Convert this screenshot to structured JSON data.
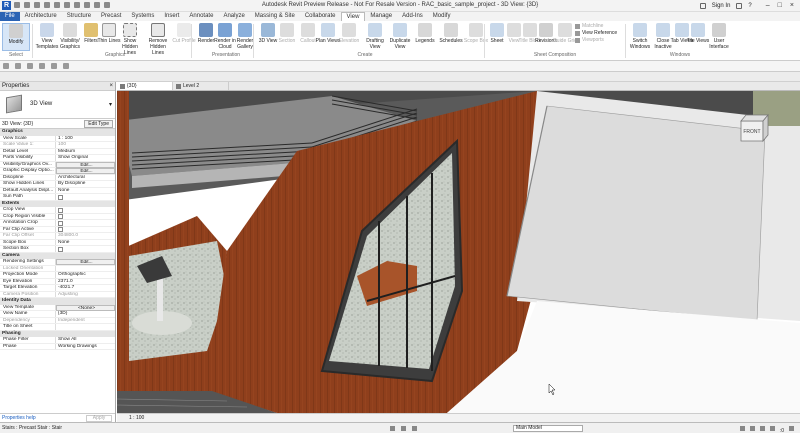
{
  "window": {
    "title": "Autodesk Revit Preview Release - Not For Resale Version - RAC_basic_sample_project - 3D View: {3D}",
    "app_logo": "R",
    "sign_in": "Sign In",
    "help": "?"
  },
  "ribbon_tabs": [
    "File",
    "Architecture",
    "Structure",
    "Precast",
    "Systems",
    "Insert",
    "Annotate",
    "Analyze",
    "Massing & Site",
    "Collaborate",
    "View",
    "Manage",
    "Add-Ins",
    "Modify"
  ],
  "active_tab": "View",
  "ribbon": {
    "modify": "Modify",
    "view_templates": "View Templates",
    "visibility_graphics": "Visibility/ Graphics",
    "filters": "Filters",
    "thin_lines": "Thin Lines",
    "show_hidden_lines": "Show Hidden Lines",
    "remove_hidden_lines": "Remove Hidden Lines",
    "cut_profile": "Cut Profile",
    "render": "Render",
    "render_in_cloud": "Render in Cloud",
    "render_gallery": "Render Gallery",
    "view_3d": "3D View",
    "section": "Section",
    "callout": "Callout",
    "plan_views": "Plan Views",
    "elevation": "Elevation",
    "drafting_view": "Drafting View",
    "duplicate_view": "Duplicate View",
    "legends": "Legends",
    "schedules": "Schedules",
    "scope_box": "Scope Box",
    "sheet": "Sheet",
    "view": "View",
    "title_block": "Title Block",
    "revisions": "Revisions",
    "guide_grid": "Guide Grid",
    "matchline": "Matchline",
    "view_reference": "View Reference",
    "viewports": "Viewports",
    "switch_windows": "Switch Windows",
    "close_inactive": "Close Inactive",
    "tab_views": "Tab Views",
    "tile_views": "Tile Views",
    "user_interface": "User Interface",
    "groups": {
      "select": "Select",
      "graphics": "Graphics",
      "presentation": "Presentation",
      "create": "Create",
      "sheet_composition": "Sheet Composition",
      "windows": "Windows"
    }
  },
  "properties": {
    "title": "Properties",
    "type_name": "3D View",
    "filter_value": "3D View: {3D}",
    "edit_type": "Edit Type",
    "sections": {
      "graphics": "Graphics",
      "extents": "Extents",
      "camera": "Camera",
      "identity": "Identity Data",
      "phasing": "Phasing"
    },
    "graphics_rows": [
      {
        "k": "View Scale",
        "v": "1 : 100"
      },
      {
        "k": "Scale Value    1:",
        "v": "100",
        "dim": true
      },
      {
        "k": "Detail Level",
        "v": "Medium"
      },
      {
        "k": "Parts Visibility",
        "v": "Show Original"
      },
      {
        "k": "Visibility/Graphics Ov...",
        "v": "Edit...",
        "btn": true
      },
      {
        "k": "Graphic Display Optio...",
        "v": "Edit...",
        "btn": true
      },
      {
        "k": "Discipline",
        "v": "Architectural"
      },
      {
        "k": "Show Hidden Lines",
        "v": "By Discipline"
      },
      {
        "k": "Default Analysis Displ...",
        "v": "None"
      },
      {
        "k": "Sun Path",
        "v": "",
        "chk": true
      }
    ],
    "extents_rows": [
      {
        "k": "Crop View",
        "v": "",
        "chk": true
      },
      {
        "k": "Crop Region Visible",
        "v": "",
        "chk": true
      },
      {
        "k": "Annotation Crop",
        "v": "",
        "chk": true
      },
      {
        "k": "Far Clip Active",
        "v": "",
        "chk": true
      },
      {
        "k": "Far Clip Offset",
        "v": "304800.0",
        "dim": true
      },
      {
        "k": "Scope Box",
        "v": "None"
      },
      {
        "k": "Section Box",
        "v": "",
        "chk": true
      }
    ],
    "camera_rows": [
      {
        "k": "Rendering Settings",
        "v": "Edit...",
        "btn": true
      },
      {
        "k": "Locked Orientation",
        "v": "",
        "dim": true
      },
      {
        "k": "Projection Mode",
        "v": "Orthographic"
      },
      {
        "k": "Eye Elevation",
        "v": "2371.0"
      },
      {
        "k": "Target Elevation",
        "v": "-4021.7"
      },
      {
        "k": "Camera Position",
        "v": "Adjusting",
        "dim": true
      }
    ],
    "identity_rows": [
      {
        "k": "View Template",
        "v": "<None>",
        "btn": true
      },
      {
        "k": "View Name",
        "v": "{3D}"
      },
      {
        "k": "Dependency",
        "v": "Independent",
        "dim": true
      },
      {
        "k": "Title on Sheet",
        "v": ""
      }
    ],
    "phasing_rows": [
      {
        "k": "Phase Filter",
        "v": "Show All"
      },
      {
        "k": "Phase",
        "v": "Working Drawings"
      }
    ],
    "help_link": "Properties help",
    "apply": "Apply"
  },
  "view_tabs": [
    {
      "label": "{3D}",
      "active": true
    },
    {
      "label": "Level 2",
      "active": false
    }
  ],
  "viewcube_label": "FRONT",
  "view_control": {
    "scale": "1 : 100"
  },
  "status": {
    "message": "Stairs : Precast Stair : Stair",
    "model": "Main Model",
    "filter_count": ":0"
  }
}
